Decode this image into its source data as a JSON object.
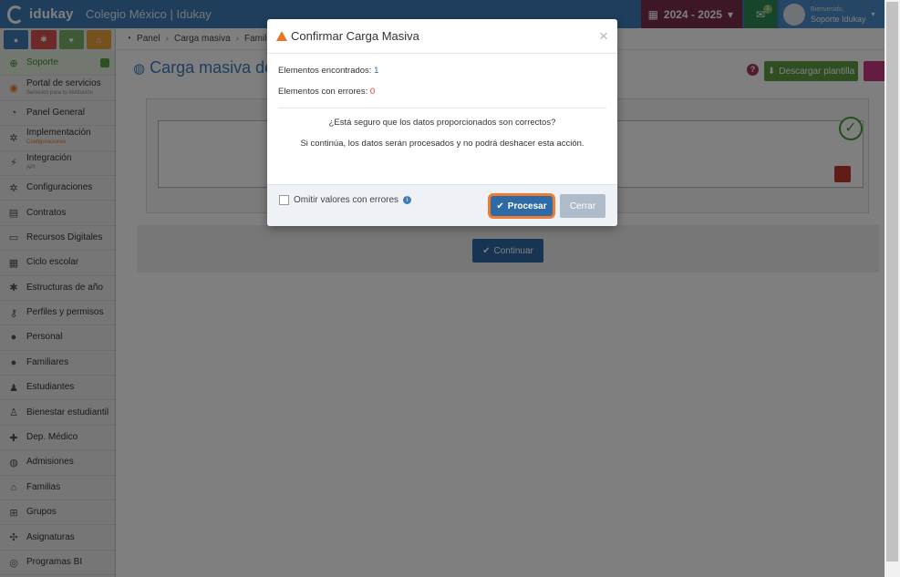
{
  "header": {
    "logo": "idukay",
    "school": "Colegio México | Idukay",
    "year": "2024 - 2025",
    "message_count": "1",
    "welcome": "Bienvenido,",
    "user_name": "Soporte Idukay"
  },
  "breadcrumb": {
    "items": [
      "Panel",
      "Carga masiva",
      "Familia"
    ]
  },
  "page": {
    "title": "Carga masiva de p",
    "download_label": "Descargar plantilla",
    "continue_label": "Continuar"
  },
  "sidebar": {
    "items": [
      {
        "label": "Soporte",
        "icon": "lifebuoy-icon"
      },
      {
        "label": "Portal de servicios",
        "sub": "Servicios para tu institución",
        "icon": "portal-icon"
      },
      {
        "label": "Panel General",
        "icon": "dashboard-icon"
      },
      {
        "label": "Implementación",
        "sub": "Configuraciones",
        "icon": "gears-icon"
      },
      {
        "label": "Integración",
        "sub": "API",
        "icon": "plug-icon"
      },
      {
        "label": "Configuraciones",
        "icon": "gears-icon"
      },
      {
        "label": "Contratos",
        "icon": "document-icon"
      },
      {
        "label": "Recursos Digitales",
        "icon": "laptop-icon"
      },
      {
        "label": "Ciclo escolar",
        "icon": "calendar-icon"
      },
      {
        "label": "Estructuras de año",
        "icon": "gear-icon"
      },
      {
        "label": "Perfiles y permisos",
        "icon": "key-icon"
      },
      {
        "label": "Personal",
        "icon": "user-icon"
      },
      {
        "label": "Familiares",
        "icon": "user-icon"
      },
      {
        "label": "Estudiantes",
        "icon": "child-icon"
      },
      {
        "label": "Bienestar estudiantil",
        "icon": "wellbeing-icon"
      },
      {
        "label": "Dep. Médico",
        "icon": "medkit-icon"
      },
      {
        "label": "Admisiones",
        "icon": "users-icon"
      },
      {
        "label": "Familias",
        "icon": "home-icon"
      },
      {
        "label": "Grupos",
        "icon": "sitemap-icon"
      },
      {
        "label": "Asignaturas",
        "icon": "puzzle-icon"
      },
      {
        "label": "Programas BI",
        "icon": "globe-icon"
      }
    ]
  },
  "modal": {
    "title": "Confirmar Carga Masiva",
    "found_label": "Elementos encontrados:",
    "found_value": "1",
    "errors_label": "Elementos con errores:",
    "errors_value": "0",
    "question": "¿Está seguro que los datos proporcionados son correctos?",
    "warning": "Si continúa, los datos serán procesados y no podrá deshacer esta acción.",
    "omit_label": "Omitir valores con errores",
    "process_label": "Procesar",
    "close_label": "Cerrar"
  },
  "colors": {
    "primary": "#3d7db8",
    "year_bg": "#7a2e4d",
    "highlight": "#ee7b30",
    "success": "#4a9b3b",
    "danger": "#d9331f"
  }
}
